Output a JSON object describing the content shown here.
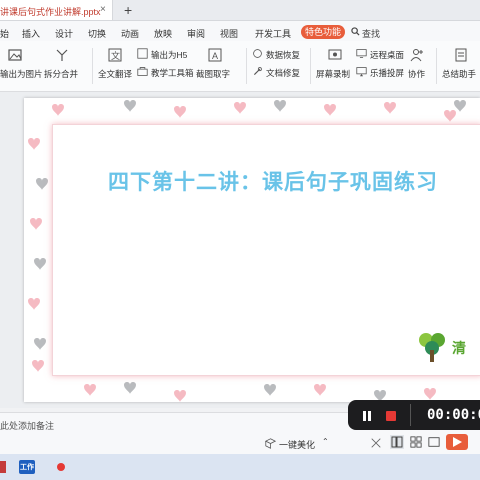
{
  "tab": {
    "title": "讲课后句式作业讲解.pptx",
    "close": "×",
    "new_tab": "+"
  },
  "menu": {
    "items": [
      "始",
      "插入",
      "设计",
      "切换",
      "动画",
      "放映",
      "审阅",
      "视图",
      "开发工具"
    ],
    "special": "特色功能",
    "search": "查找"
  },
  "ribbon": {
    "export_image": "输出为图片",
    "split_merge": "拆分合并",
    "full_translate": "全文翻译",
    "export_h5": "输出为H5",
    "teaching_tools": "教学工具箱",
    "screenshot_ocr": "截图取字",
    "data_recovery": "数据恢复",
    "doc_repair": "文档修复",
    "screen_record": "屏幕录制",
    "remote_desktop": "远程桌面",
    "lebo_cast": "乐播投屏",
    "collaborate": "协作",
    "summary_assistant": "总结助手"
  },
  "slide": {
    "title": "四下第十二讲：课后句子巩固练习",
    "logo_text": "清"
  },
  "notes": {
    "placeholder": "此处添加备注"
  },
  "statusbar": {
    "beautify": "一键美化"
  },
  "recorder": {
    "time": "00:00:0"
  },
  "taskbar": {
    "app_label": "工作"
  },
  "colors": {
    "accent": "#e85d3b",
    "title": "#69c3e8",
    "heart_pink": "#f3a9b4",
    "heart_gray": "#b9bbbe"
  }
}
